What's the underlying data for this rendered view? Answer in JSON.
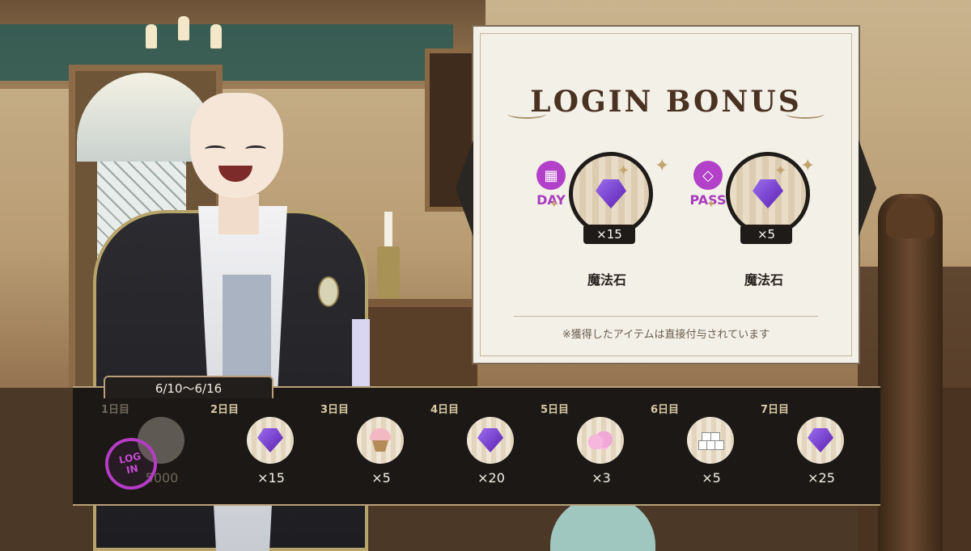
{
  "login_bonus": {
    "title": "LOGIN BONUS",
    "rewards": [
      {
        "badge_label": "DAY",
        "badge_icon": "calendar-icon",
        "quantity": "×15",
        "item_name": "魔法石"
      },
      {
        "badge_label": "PASS",
        "badge_icon": "diamond-icon",
        "quantity": "×5",
        "item_name": "魔法石"
      }
    ],
    "note": "※獲得したアイテムは直接付与されています"
  },
  "schedule": {
    "period": "6/10〜6/16",
    "stamp_text": [
      "LOG",
      "IN"
    ],
    "days": [
      {
        "label": "1日目",
        "qty": "5000",
        "icon": "money-icon",
        "claimed": true
      },
      {
        "label": "2日目",
        "qty": "×15",
        "icon": "magic-stone-icon",
        "claimed": false
      },
      {
        "label": "3日目",
        "qty": "×5",
        "icon": "cupcake-icon",
        "claimed": false
      },
      {
        "label": "4日目",
        "qty": "×20",
        "icon": "magic-stone-icon",
        "claimed": false
      },
      {
        "label": "5日目",
        "qty": "×3",
        "icon": "cotton-candy-icon",
        "claimed": false
      },
      {
        "label": "6日目",
        "qty": "×5",
        "icon": "sugar-cubes-icon",
        "claimed": false
      },
      {
        "label": "7日目",
        "qty": "×25",
        "icon": "magic-stone-icon",
        "claimed": false
      }
    ]
  },
  "colors": {
    "accent_purple": "#b240c8",
    "panel_dark": "#1b1816",
    "card_bg": "#f3f0e8",
    "gold": "#b7a078"
  }
}
